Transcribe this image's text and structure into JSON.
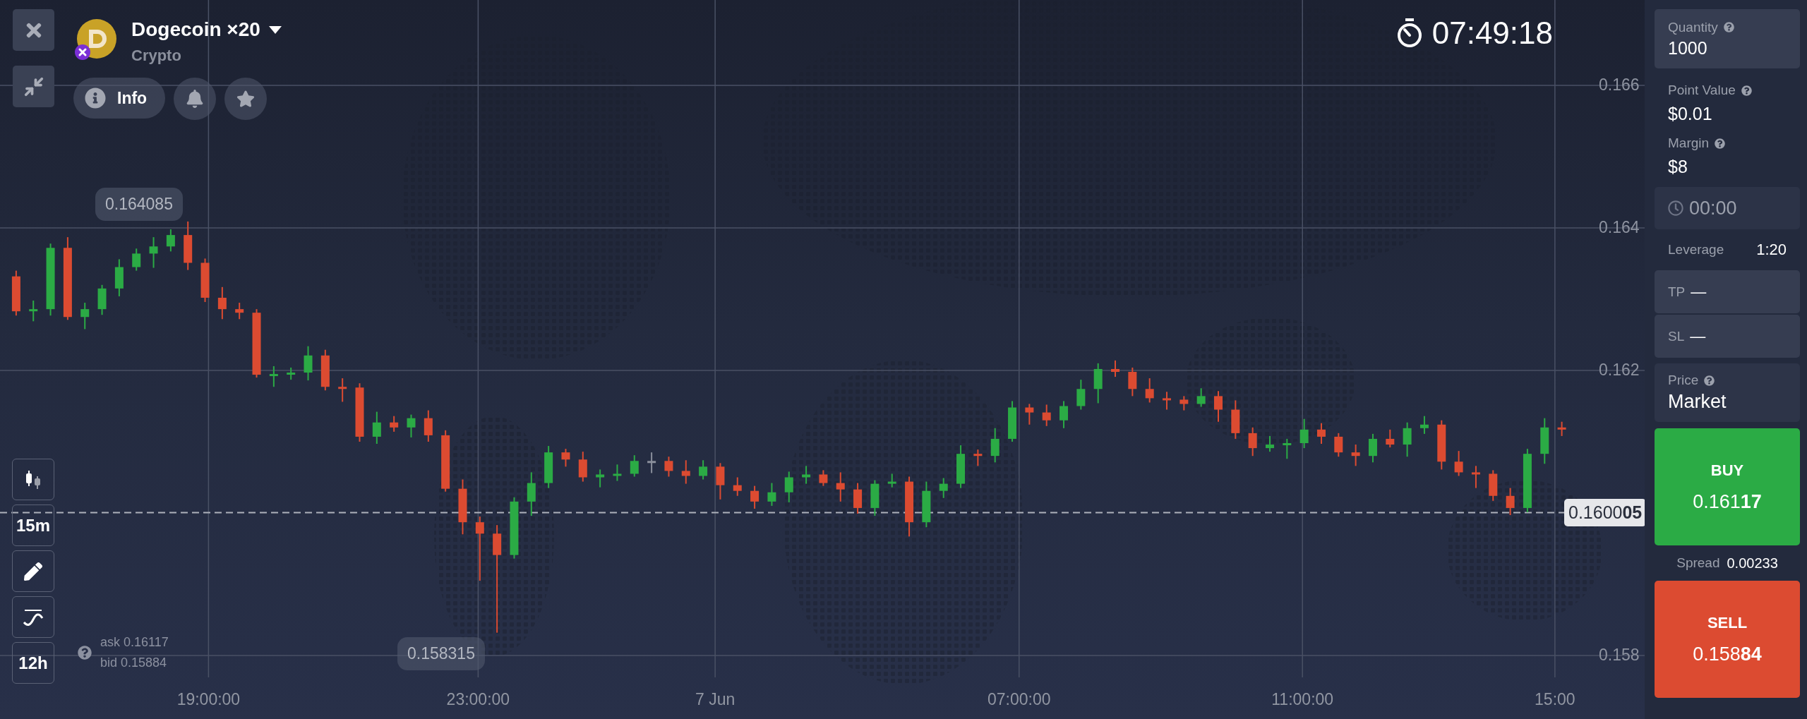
{
  "asset": {
    "title": "Dogecoin ×20",
    "category": "Crypto"
  },
  "header_buttons": {
    "info": "Info"
  },
  "timer": "07:49:18",
  "chart": {
    "chart_data": {
      "type": "candlestick",
      "ylim": [
        0.158,
        0.166
      ],
      "yticks": [
        {
          "value": 0.166,
          "label": "0.166"
        },
        {
          "value": 0.164,
          "label": "0.164"
        },
        {
          "value": 0.162,
          "label": "0.162"
        },
        {
          "value": 0.158,
          "label": "0.158"
        }
      ],
      "categories": [
        null,
        null,
        null,
        null,
        null,
        null,
        null,
        null,
        null,
        null,
        null,
        null,
        null,
        null,
        null,
        null,
        null,
        null,
        null,
        null,
        null,
        null,
        null,
        null,
        null,
        null,
        null,
        null,
        null,
        null,
        null,
        null,
        null,
        null,
        null,
        null,
        null,
        null,
        null,
        null,
        null,
        null,
        null,
        null,
        null,
        null,
        null,
        null,
        null,
        null,
        null,
        null,
        null,
        null,
        null,
        null,
        null,
        null,
        null,
        null,
        null,
        null,
        null,
        null,
        null,
        null,
        null,
        null,
        null,
        null,
        null,
        null,
        null,
        null,
        null,
        null,
        null,
        null,
        null,
        null,
        null,
        null,
        null,
        null,
        null,
        null,
        null,
        null,
        null,
        null,
        null
      ],
      "grid": true,
      "ref_lines": [
        {
          "axis": "y",
          "value": 0.160005
        }
      ],
      "ohlc": [
        [
          0.16332,
          0.1634,
          0.16277,
          0.16283
        ],
        [
          0.16283,
          0.16298,
          0.16269,
          0.16286
        ],
        [
          0.16286,
          0.16378,
          0.16277,
          0.16372
        ],
        [
          0.16372,
          0.16387,
          0.16271,
          0.16275
        ],
        [
          0.16275,
          0.16295,
          0.16258,
          0.16286
        ],
        [
          0.16286,
          0.1632,
          0.16278,
          0.16315
        ],
        [
          0.16315,
          0.16356,
          0.16304,
          0.16345
        ],
        [
          0.16345,
          0.16371,
          0.1634,
          0.16364
        ],
        [
          0.16364,
          0.16387,
          0.16344,
          0.16374
        ],
        [
          0.16374,
          0.16398,
          0.16367,
          0.1639
        ],
        [
          0.1639,
          0.16409,
          0.16341,
          0.16351
        ],
        [
          0.16351,
          0.16357,
          0.16296,
          0.16302
        ],
        [
          0.16302,
          0.16317,
          0.16272,
          0.16286
        ],
        [
          0.16286,
          0.16295,
          0.16272,
          0.16281
        ],
        [
          0.16281,
          0.16286,
          0.1619,
          0.16194
        ],
        [
          0.16194,
          0.16206,
          0.16177,
          0.16195
        ],
        [
          0.16195,
          0.16204,
          0.16187,
          0.16197
        ],
        [
          0.16197,
          0.16234,
          0.16186,
          0.16221
        ],
        [
          0.16221,
          0.16229,
          0.16172,
          0.16177
        ],
        [
          0.16177,
          0.16189,
          0.16156,
          0.16176
        ],
        [
          0.16176,
          0.16182,
          0.161,
          0.16107
        ],
        [
          0.16107,
          0.16142,
          0.16097,
          0.16127
        ],
        [
          0.16127,
          0.16136,
          0.16114,
          0.1612
        ],
        [
          0.1612,
          0.16138,
          0.16106,
          0.16133
        ],
        [
          0.16133,
          0.16144,
          0.161,
          0.16109
        ],
        [
          0.16109,
          0.16116,
          0.1603,
          0.16034
        ],
        [
          0.16034,
          0.16047,
          0.1597,
          0.15987
        ],
        [
          0.15987,
          0.15995,
          0.15905,
          0.15971
        ],
        [
          0.15971,
          0.15983,
          0.15832,
          0.15941
        ],
        [
          0.15941,
          0.16022,
          0.15936,
          0.16016
        ],
        [
          0.16016,
          0.16057,
          0.15996,
          0.16042
        ],
        [
          0.16042,
          0.16094,
          0.16035,
          0.16085
        ],
        [
          0.16085,
          0.1609,
          0.16065,
          0.16075
        ],
        [
          0.16075,
          0.16086,
          0.16044,
          0.1605
        ],
        [
          0.1605,
          0.16061,
          0.16036,
          0.16054
        ],
        [
          0.16054,
          0.16068,
          0.16045,
          0.16055
        ],
        [
          0.16055,
          0.16081,
          0.16051,
          0.16073
        ],
        [
          0.16073,
          0.16085,
          0.16056,
          0.16073
        ],
        [
          0.16073,
          0.16079,
          0.16051,
          0.16059
        ],
        [
          0.16059,
          0.16074,
          0.16041,
          0.16052
        ],
        [
          0.16052,
          0.16074,
          0.16047,
          0.16065
        ],
        [
          0.16065,
          0.1607,
          0.16019,
          0.16039
        ],
        [
          0.16039,
          0.1605,
          0.16024,
          0.16031
        ],
        [
          0.16031,
          0.16038,
          0.16006,
          0.16016
        ],
        [
          0.16016,
          0.16042,
          0.1601,
          0.16029
        ],
        [
          0.16029,
          0.16058,
          0.16015,
          0.1605
        ],
        [
          0.1605,
          0.16066,
          0.16041,
          0.16054
        ],
        [
          0.16054,
          0.1606,
          0.16038,
          0.16042
        ],
        [
          0.16042,
          0.16057,
          0.16016,
          0.16033
        ],
        [
          0.16033,
          0.16042,
          0.15999,
          0.16007
        ],
        [
          0.16007,
          0.16046,
          0.15996,
          0.16041
        ],
        [
          0.16041,
          0.16055,
          0.16036,
          0.16044
        ],
        [
          0.16044,
          0.16051,
          0.15967,
          0.15987
        ],
        [
          0.15987,
          0.16044,
          0.1598,
          0.16031
        ],
        [
          0.16031,
          0.16049,
          0.16021,
          0.16041
        ],
        [
          0.16041,
          0.16095,
          0.16035,
          0.16083
        ],
        [
          0.16083,
          0.16089,
          0.16066,
          0.1608
        ],
        [
          0.1608,
          0.16119,
          0.16071,
          0.16104
        ],
        [
          0.16104,
          0.16157,
          0.161,
          0.16148
        ],
        [
          0.16148,
          0.16153,
          0.16124,
          0.16141
        ],
        [
          0.16141,
          0.16152,
          0.16122,
          0.1613
        ],
        [
          0.1613,
          0.16157,
          0.16119,
          0.1615
        ],
        [
          0.1615,
          0.16187,
          0.16145,
          0.16174
        ],
        [
          0.16174,
          0.1621,
          0.16154,
          0.16202
        ],
        [
          0.16202,
          0.16214,
          0.16191,
          0.16198
        ],
        [
          0.16198,
          0.16204,
          0.16164,
          0.16174
        ],
        [
          0.16174,
          0.16189,
          0.16155,
          0.16161
        ],
        [
          0.16161,
          0.1617,
          0.16145,
          0.16159
        ],
        [
          0.16159,
          0.16164,
          0.16144,
          0.16153
        ],
        [
          0.16153,
          0.16175,
          0.16149,
          0.16164
        ],
        [
          0.16164,
          0.16171,
          0.16128,
          0.16145
        ],
        [
          0.16145,
          0.16158,
          0.16104,
          0.16112
        ],
        [
          0.16112,
          0.1612,
          0.1608,
          0.16091
        ],
        [
          0.16091,
          0.16108,
          0.16086,
          0.16096
        ],
        [
          0.16096,
          0.16104,
          0.16076,
          0.16098
        ],
        [
          0.16098,
          0.16132,
          0.16091,
          0.16117
        ],
        [
          0.16117,
          0.16126,
          0.16097,
          0.16107
        ],
        [
          0.16107,
          0.16112,
          0.16079,
          0.16085
        ],
        [
          0.16085,
          0.16096,
          0.16066,
          0.1608
        ],
        [
          0.1608,
          0.16111,
          0.16071,
          0.16104
        ],
        [
          0.16104,
          0.16117,
          0.16092,
          0.16096
        ],
        [
          0.16096,
          0.16127,
          0.16079,
          0.16119
        ],
        [
          0.16119,
          0.16136,
          0.16111,
          0.16124
        ],
        [
          0.16124,
          0.1613,
          0.16061,
          0.16072
        ],
        [
          0.16072,
          0.16087,
          0.16052,
          0.16057
        ],
        [
          0.16057,
          0.16066,
          0.16035,
          0.16055
        ],
        [
          0.16055,
          0.1606,
          0.16017,
          0.16024
        ],
        [
          0.16024,
          0.16035,
          0.15997,
          0.16007
        ],
        [
          0.16007,
          0.1609,
          0.16001,
          0.16083
        ],
        [
          0.16083,
          0.16133,
          0.16069,
          0.1612
        ],
        [
          0.1612,
          0.16128,
          0.16108,
          0.16117
        ]
      ]
    },
    "time_labels": [
      "19:00:00",
      "23:00:00",
      "7 Jun",
      "07:00:00",
      "11:00:00",
      "15:00"
    ],
    "high_marker": "0.164085",
    "low_marker": "0.158315",
    "current_price": "0.1600**05**",
    "ask": "ask 0.16117",
    "bid": "bid 0.15884"
  },
  "chart_tools": [
    {
      "kind": "candles"
    },
    {
      "kind": "text",
      "label": "15m"
    },
    {
      "kind": "pencil"
    },
    {
      "kind": "indicator"
    },
    {
      "kind": "text",
      "label": "12h"
    }
  ],
  "panel": {
    "quantity": {
      "label": "Quantity",
      "value": "1000"
    },
    "point_value": {
      "label": "Point Value",
      "value": "$0.01"
    },
    "margin": {
      "label": "Margin",
      "value": "$8"
    },
    "duration": "00:00",
    "leverage": {
      "label": "Leverage",
      "value": "1:20"
    },
    "take_profit": {
      "label": "TP",
      "value": "—"
    },
    "stop_loss": {
      "label": "SL",
      "value": "—"
    },
    "price": {
      "label": "Price",
      "value": "Market"
    },
    "buy": {
      "label": "BUY",
      "price": "0.161**17**"
    },
    "spread": {
      "label": "Spread",
      "value": "0.00233"
    },
    "sell": {
      "label": "SELL",
      "price": "0.158**84**"
    }
  }
}
